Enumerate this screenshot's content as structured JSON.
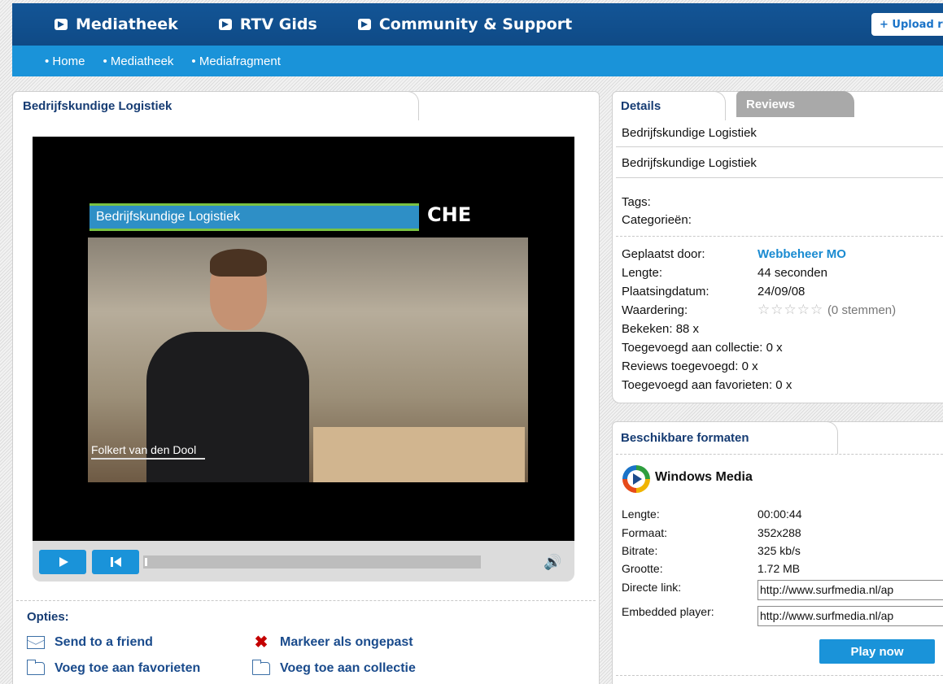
{
  "topnav": {
    "items": [
      "Mediatheek",
      "RTV Gids",
      "Community & Support"
    ],
    "upload_label": "+ Upload r"
  },
  "breadcrumb": [
    "Home",
    "Mediatheek",
    "Mediafragment"
  ],
  "main": {
    "title": "Bedrijfskundige Logistiek",
    "video": {
      "banner_text": "Bedrijfskundige Logistiek",
      "logo_text": "CHE",
      "lower_third": "Folkert van den Dool"
    },
    "options": {
      "title": "Opties:",
      "send_to_friend": "Send to a friend",
      "mark_inappropriate": "Markeer als ongepast",
      "add_favorites": "Voeg toe aan favorieten",
      "add_collection": "Voeg toe aan collectie"
    }
  },
  "details": {
    "tab_details": "Details",
    "tab_reviews": "Reviews",
    "title": "Bedrijfskundige Logistiek",
    "description": "Bedrijfskundige Logistiek",
    "tags_label": "Tags:",
    "categories_label": "Categorieën:",
    "posted_by_label": "Geplaatst door:",
    "posted_by_value": "Webbeheer MO",
    "length_label": "Lengte:",
    "length_value": "44 seconden",
    "date_label": "Plaatsingdatum:",
    "date_value": "24/09/08",
    "rating_label": "Waardering:",
    "rating_stars": "☆☆☆☆☆",
    "rating_votes": "(0 stemmen)",
    "viewed": "Bekeken:  88  x",
    "added_collection": "Toegevoegd aan collectie:  0  x",
    "reviews_added": "Reviews toegevoegd:  0  x",
    "added_favorites": "Toegevoegd aan favorieten:  0  x"
  },
  "formats": {
    "tab_title": "Beschikbare formaten",
    "format_name": "Windows Media",
    "length_label": "Lengte:",
    "length_value": "00:00:44",
    "format_label": "Formaat:",
    "format_value": "352x288",
    "bitrate_label": "Bitrate:",
    "bitrate_value": "325 kb/s",
    "size_label": "Grootte:",
    "size_value": "1.72 MB",
    "direct_link_label": "Directe link:",
    "direct_link_value": "http://www.surfmedia.nl/ap",
    "embedded_label": "Embedded player:",
    "embedded_value": "http://www.surfmedia.nl/ap",
    "play_now": "Play now"
  }
}
